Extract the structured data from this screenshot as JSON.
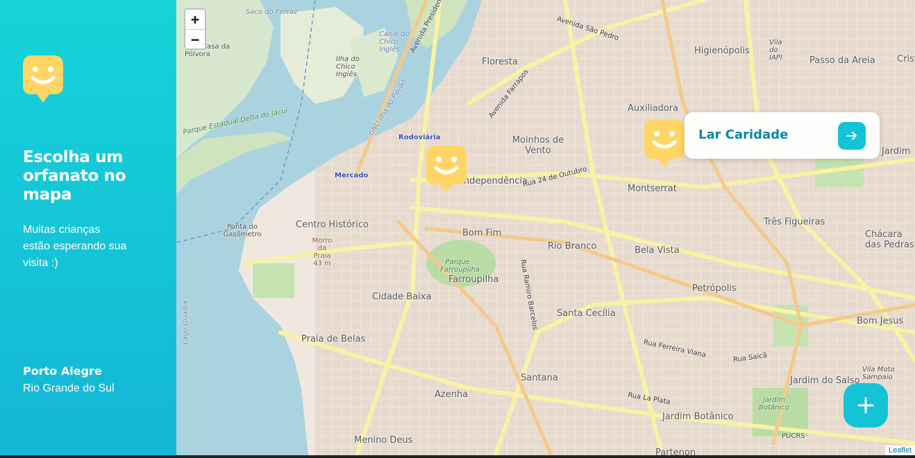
{
  "sidebar": {
    "headline": "Escolha um orfanato no mapa",
    "subtext": "Muitas crianças estão esperando sua visita :)",
    "city": "Porto Alegre",
    "state": "Rio Grande do Sul",
    "logo_icon": "smiley-marker-icon"
  },
  "colors": {
    "sidebar_top": "#15d4d9",
    "sidebar_bottom": "#15b6d6",
    "accent": "#15c3d6",
    "marker": "#ffd666",
    "popup_title": "#0089a5"
  },
  "map": {
    "zoom_in_label": "+",
    "zoom_out_label": "−",
    "attribution": "Leaflet",
    "popup": {
      "title": "Lar Caridade",
      "button_icon": "arrow-right-icon"
    },
    "add_button_icon": "plus-icon",
    "labels": {
      "saco_do_ferraz": "Saco do Ferraz",
      "casa_da_polvora": "...da Casa da Pólvora",
      "canal_chico_ingles": "Canal do Chico Inglês",
      "ilha_chico_ingles": "Ilha do Chico Inglês",
      "floresta": "Floresta",
      "higienopolis": "Higienópolis",
      "passo_da_areia": "Passo da Areia",
      "auxiliadora": "Auxiliadora",
      "moinhos_de_vento": "Moinhos de Vento",
      "independencia": "Independência",
      "montserrat": "Montserrat",
      "jardim": "Jardim",
      "tres_figueiras": "Três Figueiras",
      "chacara_das_pedras": "Chácara das Pedras",
      "rodoviaria": "Rodoviária",
      "mercado": "Mercado",
      "centro_historico": "Centro Histórico",
      "ponta_gasometro": "Ponta do Gasômetro",
      "morro_da_praia": "Morro da Praia 43 m",
      "bom_fim": "Bom Fim",
      "rio_branco": "Rio Branco",
      "bela_vista": "Bela Vista",
      "parque_farroupilha": "Parque Farroupilha",
      "farroupilha": "Farroupilha",
      "petropolis": "Petrópolis",
      "cidade_baixa": "Cidade Baixa",
      "santa_cecilia": "Santa Cecília",
      "bom_jesus": "Bom Jesus",
      "praia_de_belas": "Praia de Belas",
      "santana": "Santana",
      "jardim_do_salso": "Jardim do Salso",
      "azenha": "Azenha",
      "jardim_botanico": "Jardim Botânico",
      "menino_deus": "Menino Deus",
      "parque_delta": "Parque Estadual Delta do Jacuí",
      "av_sao_pedro": "Avenida São Pedro",
      "av_farrapos": "Avenida Farrapos",
      "rua_24_outubro": "Rua 24 de Outubro",
      "rua_ferreira_viana": "Rua Ferreira Viana",
      "rua_saica": "Rua Saicã",
      "rua_la_plata": "Rua La Plata",
      "rua_ramiro_barcelos": "Rua Ramiro Barcelos",
      "gnu_ilha_pavao": "GNU Ilha do Pavão",
      "av_castelo_branco": "Avenida Presidente Castelo Branco",
      "vila_iapi": "Vila do IAPI",
      "lago_guaiba": "Lago Guaíba",
      "pucrs": "PUCRS",
      "vila_moto_sampaio": "Vila Moto Sampaio",
      "jardim_botanico_park": "Jardim Botânico",
      "cris": "Crist",
      "partenon": "Partenon"
    }
  }
}
